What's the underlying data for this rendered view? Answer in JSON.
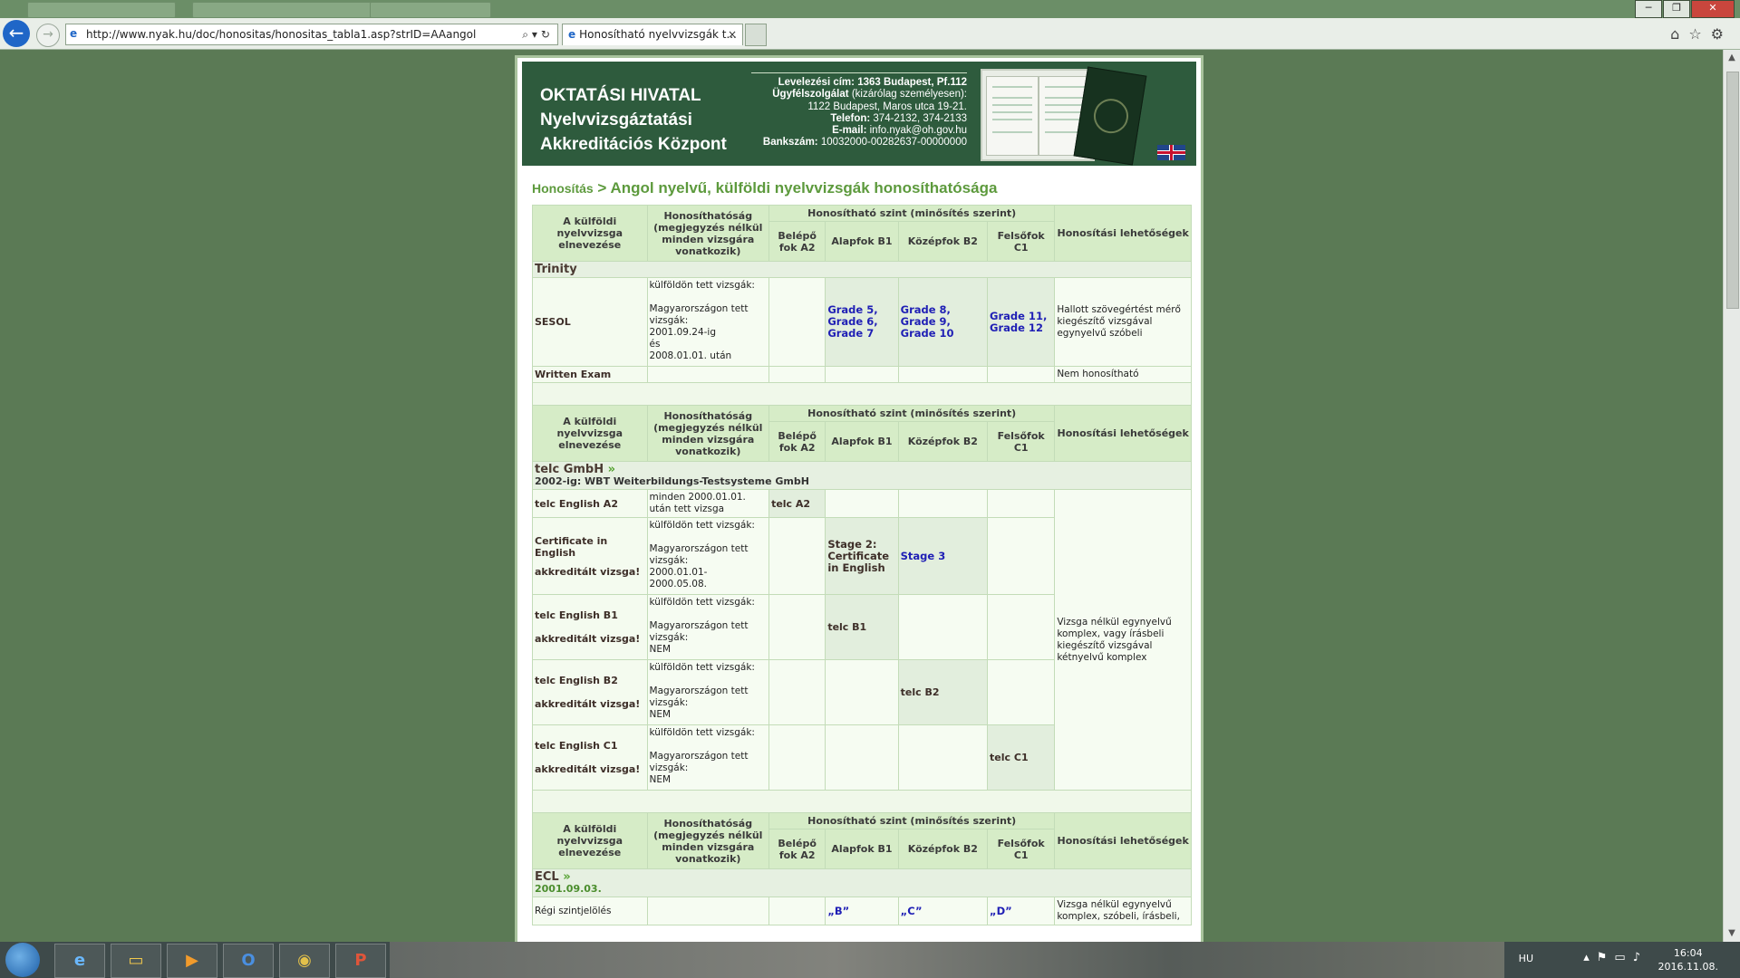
{
  "browser": {
    "address_url": "http://www.nyak.hu/doc/honositas/honositas_tabla1.asp?strID=AAangol",
    "tab_title": "Honosítható nyelvvizsgák t...",
    "tab_close": "×"
  },
  "header": {
    "org_line1": "OKTATÁSI HIVATAL",
    "org_line2": "Nyelvvizsgáztatási",
    "org_line3": "Akkreditációs Központ",
    "contact": {
      "line1_label": "Levelezési cím:",
      "line1_value": "1363 Budapest, Pf.112",
      "line2_label": "Ügyfélszolgálat",
      "line2_value": "(kizárólag személyesen):",
      "line3": "1122 Budapest, Maros utca 19-21.",
      "line4_label": "Telefon:",
      "line4_value": "374-2132, 374-2133",
      "line5_label": "E-mail:",
      "line5_value": "info.nyak@oh.gov.hu",
      "line6_label": "Bankszám:",
      "line6_value": "10032000-00282637-00000000"
    }
  },
  "breadcrumb": {
    "link": "Honosítás",
    "sep": ">",
    "title": "Angol nyelvű, külföldi nyelvvizsgák honosíthatósága"
  },
  "table_header": {
    "col_name": "A külföldi nyelvvizsga elnevezése",
    "col_hon": "Honosíthatóság (megjegyzés nélkül minden vizsgára vonatkozik)",
    "col_levels": "Honosítható szint (minősítés szerint)",
    "col_poss": "Honosítási lehetőségek",
    "lvl_a2": "Belépő fok A2",
    "lvl_b1": "Alapfok B1",
    "lvl_b2": "Középfok B2",
    "lvl_c1": "Felsőfok C1"
  },
  "trinity": {
    "group": "Trinity",
    "sesol": {
      "name": "SESOL",
      "hon_l1": "külföldön tett vizsgák:",
      "hon_l2": "Magyarországon tett vizsgák:",
      "hon_l3": "2001.09.24-ig",
      "hon_l4": "és",
      "hon_l5": "2008.01.01. után",
      "b1": "Grade 5, Grade 6, Grade 7",
      "b2": "Grade 8, Grade 9, Grade 10",
      "c1": "Grade 11, Grade 12",
      "poss": "Hallott szövegértést mérő kiegészítő vizsgával egynyelvű szóbeli"
    },
    "written": {
      "name": "Written Exam",
      "poss": "Nem honosítható"
    }
  },
  "telc": {
    "group": "telc GmbH",
    "raquo": "»",
    "sub": "2002-ig: WBT Weiterbildungs-Testsysteme GmbH",
    "a2": {
      "name": "telc English A2",
      "hon": "minden 2000.01.01. után tett vizsga",
      "a2": "telc A2"
    },
    "cie": {
      "name": "Certificate in English",
      "accr": "akkreditált vizsga!",
      "hon_l1": "külföldön tett vizsgák:",
      "hon_l2": "Magyarországon tett vizsgák:",
      "hon_l3": "2000.01.01-",
      "hon_l4": "2000.05.08.",
      "b1": "Stage 2: Certificate in English",
      "b2": "Stage 3"
    },
    "b1": {
      "name": "telc English B1",
      "accr": "akkreditált vizsga!",
      "hon_l1": "külföldön tett vizsgák:",
      "hon_l2": "Magyarországon tett vizsgák:",
      "hon_l3": "NEM",
      "level": "telc B1"
    },
    "b2": {
      "name": "telc English B2",
      "accr": "akkreditált vizsga!",
      "hon_l1": "külföldön tett vizsgák:",
      "hon_l2": "Magyarországon tett vizsgák:",
      "hon_l3": "NEM",
      "level": "telc B2"
    },
    "c1": {
      "name": "telc English C1",
      "accr": "akkreditált vizsga!",
      "hon_l1": "külföldön tett vizsgák:",
      "hon_l2": "Magyarországon tett vizsgák:",
      "hon_l3": "NEM",
      "level": "telc C1"
    },
    "poss": "Vizsga nélkül egynyelvű komplex, vagy írásbeli kiegészítő vizsgával kétnyelvű komplex"
  },
  "ecl": {
    "group": "ECL",
    "raquo": "»",
    "date": "2001.09.03.",
    "row_name": "Régi szintjelölés",
    "b1": "„B”",
    "b2": "„C”",
    "c1": "„D”",
    "poss": "Vizsga nélkül egynyelvű komplex, szóbeli, írásbeli,"
  },
  "taskbar": {
    "lang": "HU",
    "time": "16:04",
    "date": "2016.11.08."
  },
  "colors": {
    "page_bg": "#5b7a55",
    "header_green": "#2e5b3d",
    "table_head": "#d6ecc7",
    "level_link": "#1f1fb5",
    "breadcrumb": "#5d9a3d"
  }
}
